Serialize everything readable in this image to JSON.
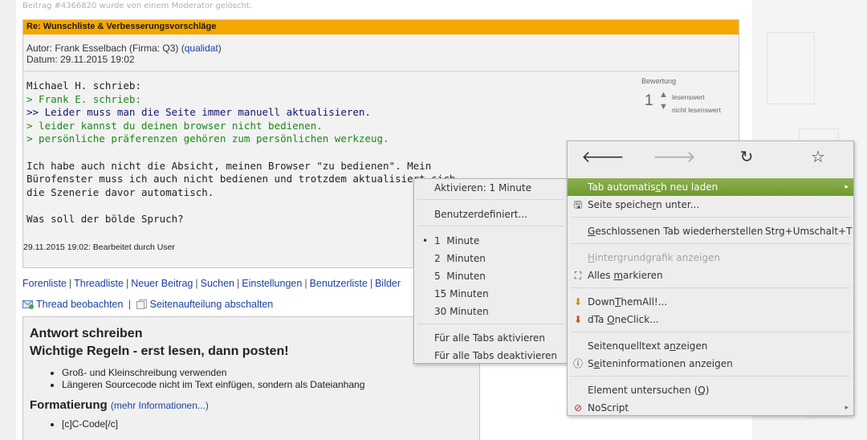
{
  "deleted_note": "Beitrag #4366820 wurde von einem Moderator gelöscht.",
  "post": {
    "title": "Re: Wunschliste & Verbesserungsvorschläge",
    "author_prefix": "Autor: Frank Esselbach (Firma: Q3) (",
    "author_link": "qualidat",
    "author_suffix": ")",
    "date": "Datum: 29.11.2015 19:02",
    "lines": [
      {
        "text": "Michael H. schrieb:",
        "style": "normal"
      },
      {
        "text": "> Frank E. schrieb:",
        "style": "q1"
      },
      {
        "text": ">> Leider muss man die Seite immer manuell aktualisieren.",
        "style": "q2"
      },
      {
        "text": "> leider kannst du deinen browser nicht bedienen.",
        "style": "q1"
      },
      {
        "text": "> persönliche präferenzen gehören zum persönlichen werkzeug.",
        "style": "q1"
      },
      {
        "text": "",
        "style": "normal"
      },
      {
        "text": "Ich habe auch nicht die Absicht, meinen Browser \"zu bedienen\". Mein",
        "style": "normal"
      },
      {
        "text": "Bürofenster muss ich auch nicht bedienen und trotzdem aktualisiert sich",
        "style": "normal"
      },
      {
        "text": "die Szenerie davor automatisch.",
        "style": "normal"
      },
      {
        "text": "",
        "style": "normal"
      },
      {
        "text": "Was soll der bölde Spruch?",
        "style": "normal"
      }
    ],
    "edit_note": "29.11.2015 19:02: Bearbeitet durch User",
    "rating": {
      "label": "Bewertung",
      "score": "1",
      "up_label": "lesenswert",
      "down_label": "nicht lesenswert"
    }
  },
  "nav_links": [
    "Forenliste",
    "Threadliste",
    "Neuer Beitrag",
    "Suchen",
    "Einstellungen",
    "Benutzerliste",
    "Bilder"
  ],
  "watch": {
    "thread": "Thread beobachten",
    "split": "Seitenaufteilung abschalten"
  },
  "reply": {
    "heading1": "Antwort schreiben",
    "heading2": "Wichtige Regeln - erst lesen, dann posten!",
    "rules": [
      "Groß- und Kleinschreibung verwenden",
      "Längeren Sourcecode nicht im Text einfügen, sondern als Dateianhang"
    ],
    "format_heading": "Formatierung",
    "format_link": "(mehr Informationen...)",
    "format_items": [
      "[c]C-Code[/c]"
    ]
  },
  "submenu": {
    "activate": "Aktivieren: 1 Minute",
    "custom": "Benutzerdefiniert...",
    "intervals": [
      "1  Minute",
      "2  Minuten",
      "5  Minuten",
      "15 Minuten",
      "30 Minuten"
    ],
    "selected_index": 0,
    "all_on": "Für alle Tabs aktivieren",
    "all_off": "Für alle Tabs deaktivieren"
  },
  "mainmenu": {
    "nav_icons": [
      "back-icon",
      "forward-icon",
      "reload-icon",
      "bookmark-star-icon"
    ],
    "auto_reload": "Tab automatisch neu laden",
    "save_page": "Seite speichern unter...",
    "restore_tab": "Geschlossenen Tab wiederherstellen",
    "restore_shortcut": "Strg+Umschalt+T",
    "bg_image": "Hintergrundgrafik anzeigen",
    "select_all": "Alles markieren",
    "downthemall": "DownThemAll!...",
    "dta_oneclick": "dTa OneClick...",
    "view_source": "Seitenquelltext anzeigen",
    "page_info": "Seiteninformationen anzeigen",
    "inspect": "Element untersuchen (Q)",
    "noscript": "NoScript"
  },
  "colors": {
    "title_bar": "#f5a700",
    "menu_highlight": "#7ea23e",
    "link": "#1a3fa0",
    "quote_green": "#1a8a1a",
    "quote_navy": "#11116e"
  }
}
